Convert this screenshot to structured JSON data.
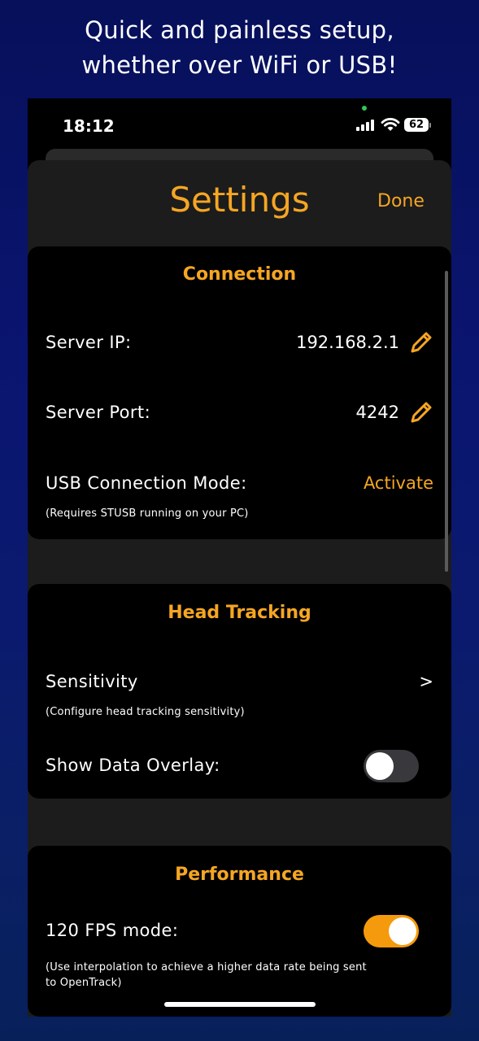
{
  "promo": {
    "line1": "Quick and painless setup,",
    "line2": "whether over WiFi or USB!"
  },
  "status_bar": {
    "time": "18:12",
    "battery": "62",
    "icons": [
      "signal-icon",
      "wifi-icon",
      "battery-icon"
    ]
  },
  "nav": {
    "title": "Settings",
    "done_label": "Done"
  },
  "connection": {
    "title": "Connection",
    "server_ip_label": "Server IP:",
    "server_ip_value": "192.168.2.1",
    "server_port_label": "Server Port:",
    "server_port_value": "4242",
    "usb_label": "USB Connection Mode:",
    "usb_action": "Activate",
    "usb_sub": "(Requires STUSB running on your PC)"
  },
  "head_tracking": {
    "title": "Head Tracking",
    "sensitivity_label": "Sensitivity",
    "sensitivity_chevron": ">",
    "sensitivity_sub": "(Configure head tracking sensitivity)",
    "overlay_label": "Show Data Overlay:",
    "overlay_on": false
  },
  "performance": {
    "title": "Performance",
    "fps_label": "120 FPS mode:",
    "fps_on": true,
    "fps_sub_line1": "(Use interpolation to achieve a higher data rate being sent",
    "fps_sub_line2": "to OpenTrack)"
  },
  "colors": {
    "accent": "#f5a623",
    "toggle_on": "#f59a0c",
    "toggle_off": "#39393d",
    "card_bg": "#000000",
    "sheet_bg": "#1c1c1c"
  }
}
